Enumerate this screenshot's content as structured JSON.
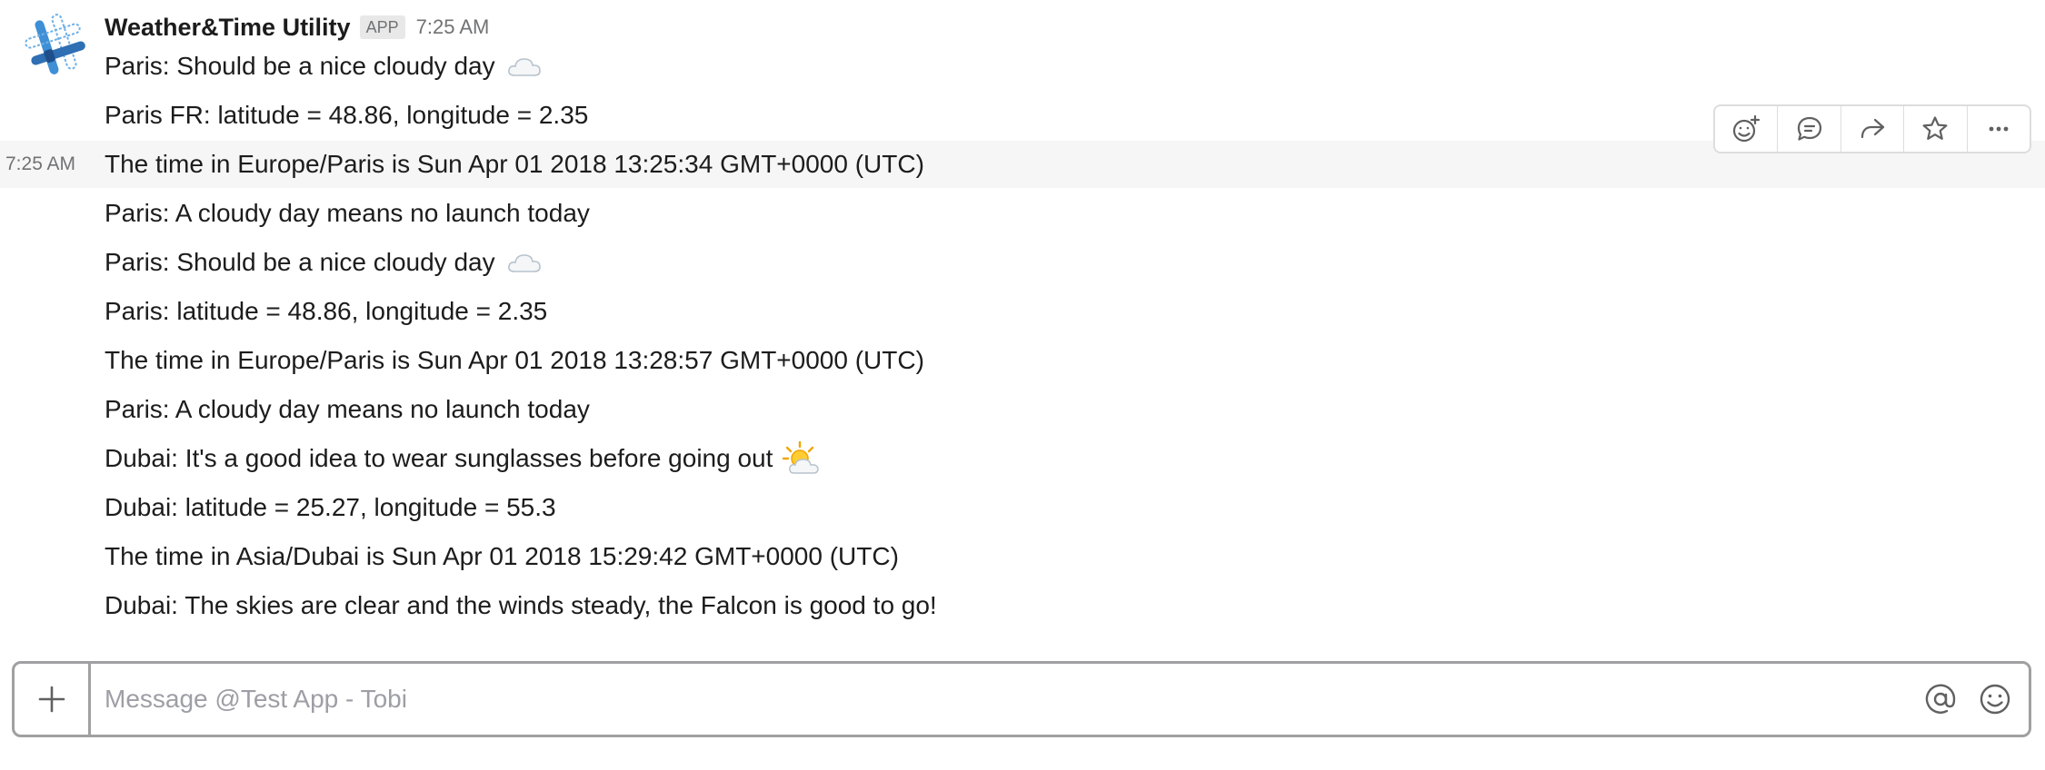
{
  "app": {
    "name": "Weather&Time Utility",
    "badge": "APP",
    "time": "7:25 AM"
  },
  "messages": [
    {
      "text": "Paris: Should be a nice cloudy day",
      "emoji": "cloud-icon"
    },
    {
      "text": "Paris FR: latitude = 48.86, longitude = 2.35"
    },
    {
      "text": "The time in Europe/Paris is Sun Apr 01 2018 13:25:34 GMT+0000 (UTC)",
      "hover_time": "7:25 AM"
    },
    {
      "text": "Paris:  A cloudy day means no launch today"
    },
    {
      "text": "Paris: Should be a nice cloudy day",
      "emoji": "cloud-icon"
    },
    {
      "text": "Paris: latitude = 48.86, longitude = 2.35"
    },
    {
      "text": "The time in Europe/Paris is Sun Apr 01 2018 13:28:57 GMT+0000 (UTC)"
    },
    {
      "text": "Paris:  A cloudy day means no launch today"
    },
    {
      "text": "Dubai:  It's a good idea to wear sunglasses before going out",
      "emoji": "sun-behind-cloud-icon"
    },
    {
      "text": "Dubai: latitude = 25.27, longitude = 55.3"
    },
    {
      "text": "The time in Asia/Dubai is Sun Apr 01 2018 15:29:42 GMT+0000 (UTC)"
    },
    {
      "text": "Dubai: The skies are clear and the winds steady, the Falcon is good to go!"
    }
  ],
  "actions": [
    "add-reaction-icon",
    "start-thread-icon",
    "share-icon",
    "star-icon",
    "more-actions-icon"
  ],
  "composer": {
    "placeholder": "Message @Test App - Tobi"
  },
  "colors": {
    "text": "#1d1c1d",
    "muted": "#717274",
    "hover_row": "#f6f6f6",
    "border": "#a0a0a2"
  }
}
